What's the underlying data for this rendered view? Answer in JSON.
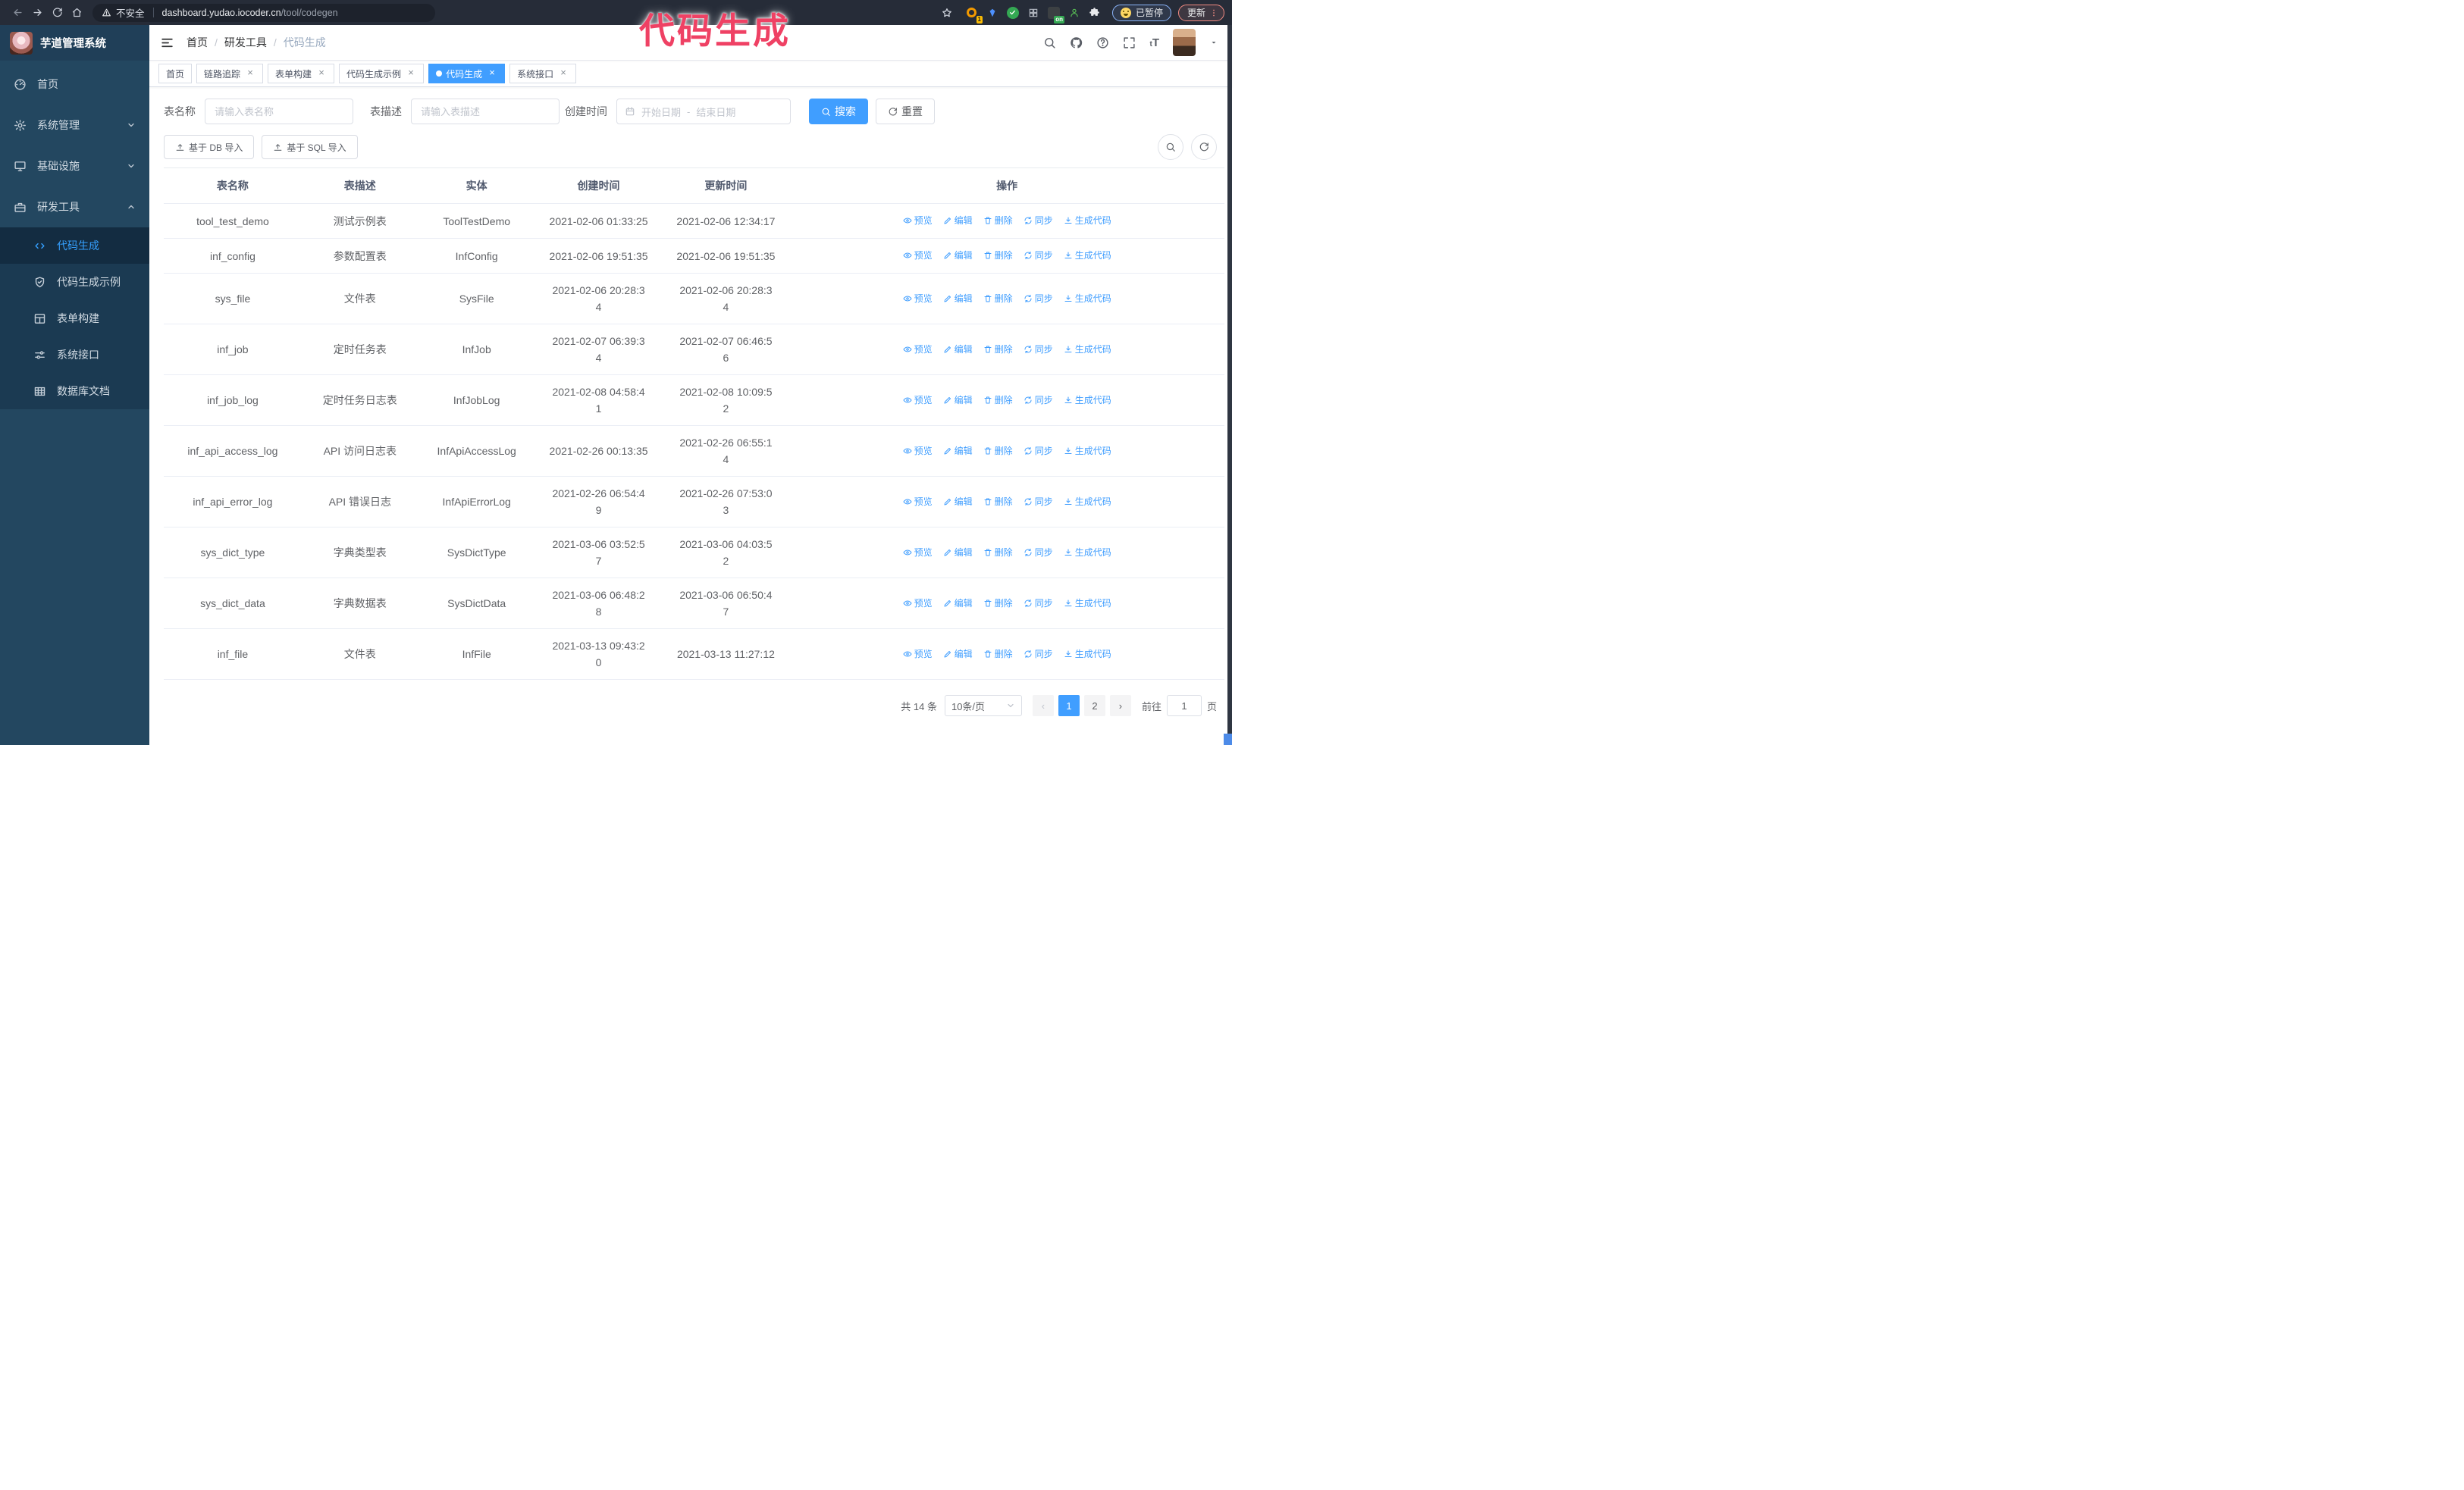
{
  "colors": {
    "accent": "#409eff",
    "overlay_text": "#ef4164",
    "sidebar_bg": "#234760",
    "submenu_bg": "#1b3a52",
    "active_item_bg": "#132c41",
    "browser_bar_bg": "#262c38"
  },
  "overlay_title": "代码生成",
  "browser": {
    "security_warning": "不安全",
    "url_domain": "dashboard.yudao.iocoder.cn",
    "url_path": "/tool/codegen",
    "ext_badge_1": "1",
    "ext_badge_on": "on",
    "paused_label": "已暂停",
    "update_label": "更新"
  },
  "sidebar": {
    "app_title": "芋道管理系统",
    "items": [
      {
        "key": "home",
        "label": "首页",
        "icon": "dashboard"
      },
      {
        "key": "system-manage",
        "label": "系统管理",
        "icon": "gear",
        "chevron": "down"
      },
      {
        "key": "infrastructure",
        "label": "基础设施",
        "icon": "monitor",
        "chevron": "down"
      },
      {
        "key": "dev-tools",
        "label": "研发工具",
        "icon": "toolbox",
        "chevron": "up",
        "children": [
          {
            "key": "codegen",
            "label": "代码生成",
            "icon": "code",
            "active": true
          },
          {
            "key": "codegen-example",
            "label": "代码生成示例",
            "icon": "shield"
          },
          {
            "key": "form-builder",
            "label": "表单构建",
            "icon": "form"
          },
          {
            "key": "system-api",
            "label": "系统接口",
            "icon": "sliders"
          },
          {
            "key": "db-doc",
            "label": "数据库文档",
            "icon": "dbtable"
          }
        ]
      }
    ]
  },
  "header": {
    "breadcrumb": [
      "首页",
      "研发工具",
      "代码生成"
    ]
  },
  "tabs": [
    {
      "key": "home",
      "label": "首页",
      "closable": false
    },
    {
      "key": "trace",
      "label": "链路追踪",
      "closable": true
    },
    {
      "key": "form-builder",
      "label": "表单构建",
      "closable": true
    },
    {
      "key": "codegen-example",
      "label": "代码生成示例",
      "closable": true
    },
    {
      "key": "codegen",
      "label": "代码生成",
      "closable": true,
      "active": true
    },
    {
      "key": "system-api",
      "label": "系统接口",
      "closable": true
    }
  ],
  "search": {
    "name_label": "表名称",
    "name_placeholder": "请输入表名称",
    "desc_label": "表描述",
    "desc_placeholder": "请输入表描述",
    "time_label": "创建时间",
    "date_start": "开始日期",
    "date_sep": "-",
    "date_end": "结束日期",
    "search_button": "搜索",
    "reset_button": "重置"
  },
  "toolbar": {
    "db_import": "基于 DB 导入",
    "sql_import": "基于 SQL 导入"
  },
  "table": {
    "columns": [
      "表名称",
      "表描述",
      "实体",
      "创建时间",
      "更新时间",
      "操作"
    ],
    "actions": [
      {
        "key": "preview",
        "label": "预览",
        "icon": "eye"
      },
      {
        "key": "edit",
        "label": "编辑",
        "icon": "pencil"
      },
      {
        "key": "delete",
        "label": "删除",
        "icon": "trash"
      },
      {
        "key": "sync",
        "label": "同步",
        "icon": "sync"
      },
      {
        "key": "generate",
        "label": "生成代码",
        "icon": "download"
      }
    ],
    "rows": [
      {
        "name": "tool_test_demo",
        "desc": "测试示例表",
        "entity": "ToolTestDemo",
        "created": [
          "2021-02-06 01:33:25"
        ],
        "updated": [
          "2021-02-06 12:34:17"
        ]
      },
      {
        "name": "inf_config",
        "desc": "参数配置表",
        "entity": "InfConfig",
        "created": [
          "2021-02-06 19:51:35"
        ],
        "updated": [
          "2021-02-06 19:51:35"
        ]
      },
      {
        "name": "sys_file",
        "desc": "文件表",
        "entity": "SysFile",
        "created": [
          "2021-02-06 20:28:3",
          "4"
        ],
        "updated": [
          "2021-02-06 20:28:3",
          "4"
        ]
      },
      {
        "name": "inf_job",
        "desc": "定时任务表",
        "entity": "InfJob",
        "created": [
          "2021-02-07 06:39:3",
          "4"
        ],
        "updated": [
          "2021-02-07 06:46:5",
          "6"
        ]
      },
      {
        "name": "inf_job_log",
        "desc": "定时任务日志表",
        "entity": "InfJobLog",
        "created": [
          "2021-02-08 04:58:4",
          "1"
        ],
        "updated": [
          "2021-02-08 10:09:5",
          "2"
        ]
      },
      {
        "name": "inf_api_access_log",
        "desc": "API 访问日志表",
        "entity": "InfApiAccessLog",
        "created": [
          "2021-02-26 00:13:35"
        ],
        "updated": [
          "2021-02-26 06:55:1",
          "4"
        ]
      },
      {
        "name": "inf_api_error_log",
        "desc": "API 错误日志",
        "entity": "InfApiErrorLog",
        "created": [
          "2021-02-26 06:54:4",
          "9"
        ],
        "updated": [
          "2021-02-26 07:53:0",
          "3"
        ]
      },
      {
        "name": "sys_dict_type",
        "desc": "字典类型表",
        "entity": "SysDictType",
        "created": [
          "2021-03-06 03:52:5",
          "7"
        ],
        "updated": [
          "2021-03-06 04:03:5",
          "2"
        ]
      },
      {
        "name": "sys_dict_data",
        "desc": "字典数据表",
        "entity": "SysDictData",
        "created": [
          "2021-03-06 06:48:2",
          "8"
        ],
        "updated": [
          "2021-03-06 06:50:4",
          "7"
        ]
      },
      {
        "name": "inf_file",
        "desc": "文件表",
        "entity": "InfFile",
        "created": [
          "2021-03-13 09:43:2",
          "0"
        ],
        "updated": [
          "2021-03-13 11:27:12"
        ]
      }
    ]
  },
  "pagination": {
    "total": "共 14 条",
    "size": "10条/页",
    "pages": [
      "1",
      "2"
    ],
    "active_page": "1",
    "goto_label": "前往",
    "goto_value": "1",
    "page_unit": "页"
  }
}
